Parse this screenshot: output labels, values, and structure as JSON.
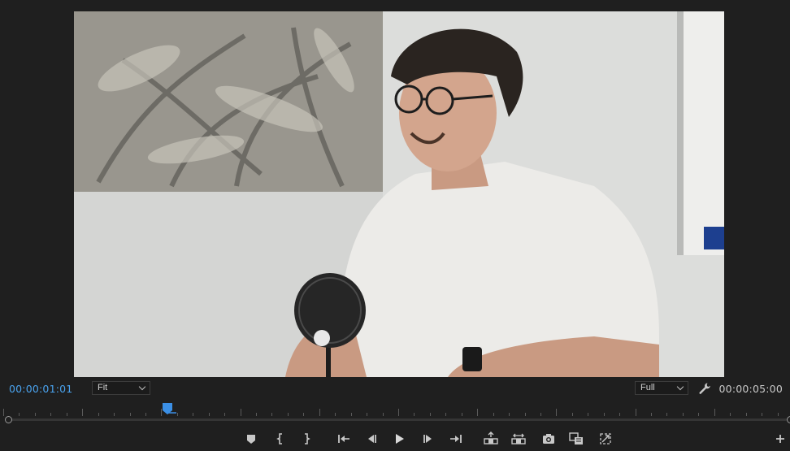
{
  "timecodes": {
    "current": "00:00:01:01",
    "duration": "00:00:05:00"
  },
  "zoom_select": {
    "value": "Fit"
  },
  "resolution_select": {
    "value": "Full"
  },
  "playhead": {
    "position_fraction": 0.21
  },
  "colors": {
    "accent": "#4aa3ef",
    "panel_bg": "#1f1f1f",
    "icon": "#c8c8c8"
  },
  "icons": {
    "settings": "wrench-icon",
    "transport": [
      "add-marker-icon",
      "mark-in-icon",
      "mark-out-icon",
      "go-to-in-icon",
      "step-back-icon",
      "play-icon",
      "step-forward-icon",
      "go-to-out-icon",
      "lift-icon",
      "extract-icon",
      "export-frame-icon",
      "comparison-view-icon",
      "vr-video-icon",
      "plus-icon"
    ]
  }
}
